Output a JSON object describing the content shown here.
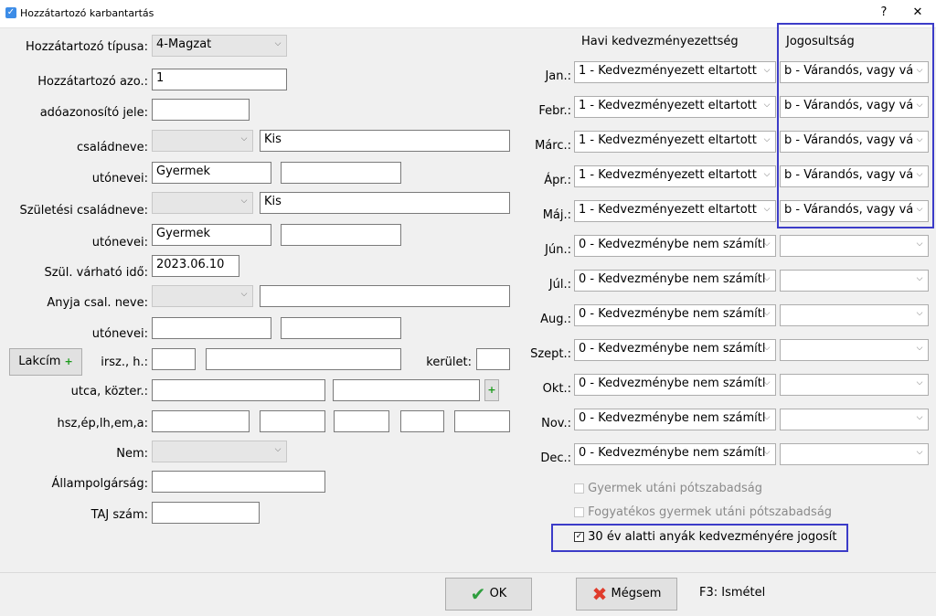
{
  "window": {
    "title": "Hozzátartozó karbantartás",
    "help_btn": "?",
    "close_btn": "✕"
  },
  "left": {
    "type_label": "Hozzátartozó típusa:",
    "type_value": "4-Magzat",
    "id_label": "Hozzátartozó azo.:",
    "id_value": "1",
    "tax_label": "adóazonosító jele:",
    "tax_value": "",
    "family_label": "családneve:",
    "family_prefix": "",
    "family_value": "Kis",
    "given_label": "utónevei:",
    "given1": "Gyermek",
    "given2": "",
    "birth_family_label": "Születési családneve:",
    "birth_family_prefix": "",
    "birth_family_value": "Kis",
    "birth_given_label": "utónevei:",
    "birth_given1": "Gyermek",
    "birth_given2": "",
    "expected_date_label": "Szül. várható idő:",
    "expected_date_value": "2023.06.10",
    "mother_label": "Anyja csal. neve:",
    "mother_prefix": "",
    "mother_value": "",
    "mother_given_label": "utónevei:",
    "mother_given1": "",
    "mother_given2": "",
    "address_button": "Lakcím",
    "zip_label": "irsz., h.:",
    "district_label": "kerület:",
    "street_label": "utca, közter.:",
    "house_label": "hsz,ép,lh,em,a:",
    "gender_label": "Nem:",
    "gender_value": "",
    "citizenship_label": "Állampolgárság:",
    "citizenship_value": "",
    "taj_label": "TAJ szám:",
    "taj_value": ""
  },
  "right": {
    "col1_header": "Havi kedvezményezettség",
    "col2_header": "Jogosultság",
    "months": [
      {
        "label": "Jan.:",
        "benefit": "1 - Kedvezményezett eltartott",
        "entitlement": "b - Várandós, vagy vá"
      },
      {
        "label": "Febr.:",
        "benefit": "1 - Kedvezményezett eltartott",
        "entitlement": "b - Várandós, vagy vá"
      },
      {
        "label": "Márc.:",
        "benefit": "1 - Kedvezményezett eltartott",
        "entitlement": "b - Várandós, vagy vá"
      },
      {
        "label": "Ápr.:",
        "benefit": "1 - Kedvezményezett eltartott",
        "entitlement": "b - Várandós, vagy vá"
      },
      {
        "label": "Máj.:",
        "benefit": "1 - Kedvezményezett eltartott",
        "entitlement": "b - Várandós, vagy vá"
      },
      {
        "label": "Jún.:",
        "benefit": "0 - Kedvezménybe nem számítl",
        "entitlement": ""
      },
      {
        "label": "Júl.:",
        "benefit": "0 - Kedvezménybe nem számítl",
        "entitlement": ""
      },
      {
        "label": "Aug.:",
        "benefit": "0 - Kedvezménybe nem számítl",
        "entitlement": ""
      },
      {
        "label": "Szept.:",
        "benefit": "0 - Kedvezménybe nem számítl",
        "entitlement": ""
      },
      {
        "label": "Okt.:",
        "benefit": "0 - Kedvezménybe nem számítl",
        "entitlement": ""
      },
      {
        "label": "Nov.:",
        "benefit": "0 - Kedvezménybe nem számítl",
        "entitlement": ""
      },
      {
        "label": "Dec.:",
        "benefit": "0 - Kedvezménybe nem számítl",
        "entitlement": ""
      }
    ],
    "chk_child_leave": "Gyermek utáni pótszabadság",
    "chk_disabled_leave": "Fogyatékos gyermek utáni pótszabadság",
    "chk_under30": "30 év alatti anyák kedvezményére jogosít"
  },
  "footer": {
    "ok": "OK",
    "cancel": "Mégsem",
    "repeat_hint": "F3: Ismétel"
  },
  "colors": {
    "highlight": "#3c3cc8",
    "ok_green": "#2e9e3e",
    "cancel_red": "#e03c2c"
  }
}
